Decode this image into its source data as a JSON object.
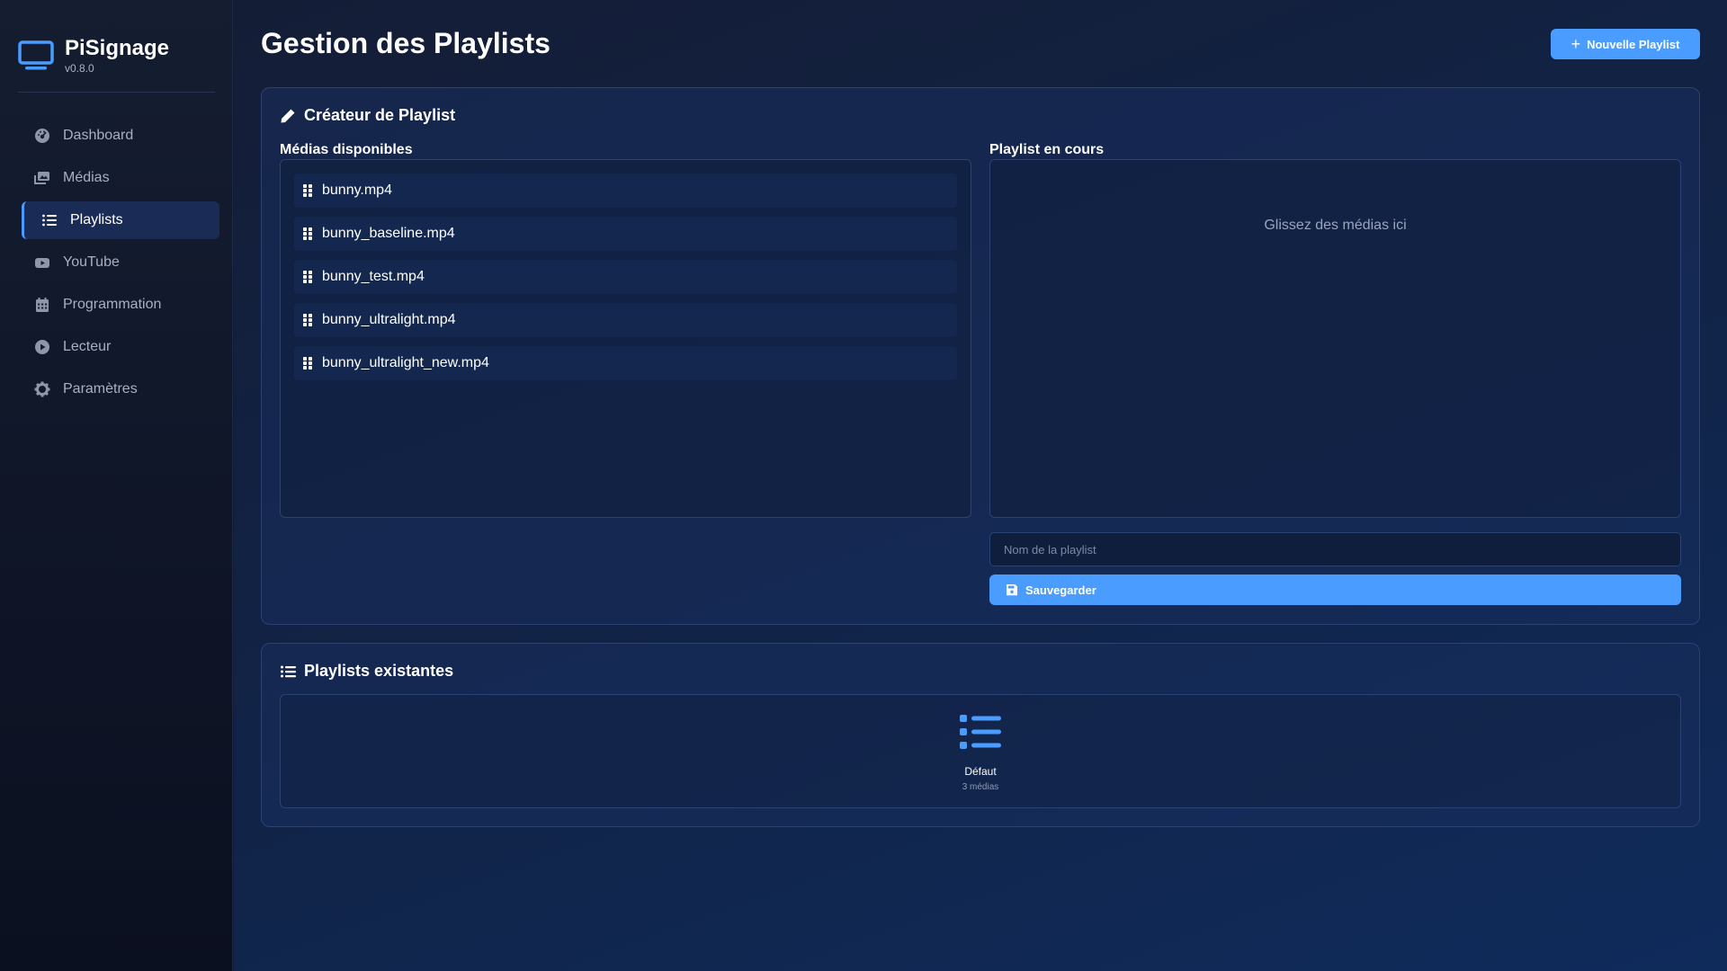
{
  "brand": {
    "name": "PiSignage",
    "version": "v0.8.0",
    "icon": "tv-icon"
  },
  "sidebar": {
    "items": [
      {
        "label": "Dashboard",
        "icon": "dashboard-icon",
        "active": false
      },
      {
        "label": "Médias",
        "icon": "images-icon",
        "active": false
      },
      {
        "label": "Playlists",
        "icon": "list-icon",
        "active": true
      },
      {
        "label": "YouTube",
        "icon": "youtube-icon",
        "active": false
      },
      {
        "label": "Programmation",
        "icon": "calendar-icon",
        "active": false
      },
      {
        "label": "Lecteur",
        "icon": "play-circle-icon",
        "active": false
      },
      {
        "label": "Paramètres",
        "icon": "gear-icon",
        "active": false
      }
    ]
  },
  "header": {
    "title": "Gestion des Playlists",
    "new_button": "Nouvelle Playlist"
  },
  "creator": {
    "title": "Créateur de Playlist",
    "available_label": "Médias disponibles",
    "current_label": "Playlist en cours",
    "media": [
      "bunny.mp4",
      "bunny_baseline.mp4",
      "bunny_test.mp4",
      "bunny_ultralight.mp4",
      "bunny_ultralight_new.mp4"
    ],
    "drop_hint": "Glissez des médias ici",
    "name_placeholder": "Nom de la playlist",
    "save_label": "Sauvegarder"
  },
  "existing": {
    "title": "Playlists existantes",
    "playlists": [
      {
        "name": "Défaut",
        "count": "3 médias"
      }
    ]
  },
  "colors": {
    "accent": "#4a9cff",
    "background": "#112448",
    "sidebar": "#0f1629"
  }
}
